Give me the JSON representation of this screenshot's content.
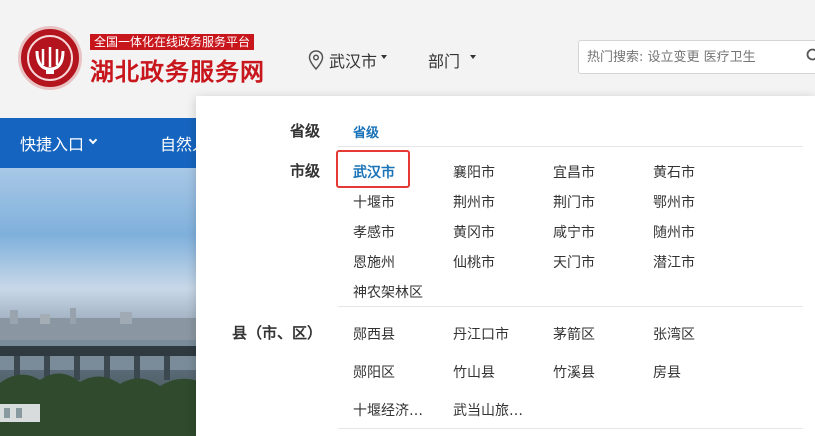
{
  "header": {
    "slogan": "全国一体化在线政务服务平台",
    "site_title": "湖北政务服务网",
    "location_label": "武汉市",
    "department_label": "部门",
    "search_placeholder": "热门搜索: 设立变更 医疗卫生"
  },
  "nav": {
    "quick_entry": "快捷入口",
    "nature": "自然人"
  },
  "dropdown": {
    "province_label": "省级",
    "province_options": [
      "省级"
    ],
    "city_label": "市级",
    "city_options": [
      "武汉市",
      "襄阳市",
      "宜昌市",
      "黄石市",
      "十堰市",
      "荆州市",
      "荆门市",
      "鄂州市",
      "孝感市",
      "黄冈市",
      "咸宁市",
      "随州市",
      "恩施州",
      "仙桃市",
      "天门市",
      "潜江市",
      "神农架林区"
    ],
    "selected_city": "武汉市",
    "county_label": "县（市、区）",
    "county_options": [
      "郧西县",
      "丹江口市",
      "茅箭区",
      "张湾区",
      "郧阳区",
      "竹山县",
      "竹溪县",
      "房县",
      "十堰经济…",
      "武当山旅…"
    ]
  },
  "colors": {
    "brand_red": "#c8161d",
    "nav_blue": "#1565c0",
    "active_link": "#1a73b8",
    "selection_border": "#e53935"
  }
}
